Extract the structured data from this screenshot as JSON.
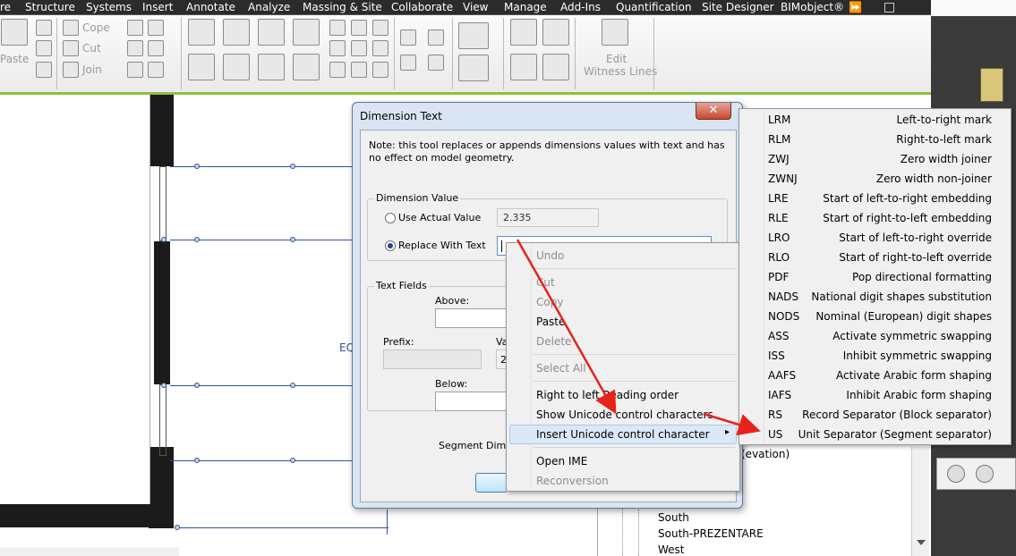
{
  "menubar": {
    "items": [
      "re",
      "Structure",
      "Systems",
      "Insert",
      "Annotate",
      "Analyze",
      "Massing & Site",
      "Collaborate",
      "View",
      "Manage",
      "Add-Ins",
      "Quantification",
      "Site Designer",
      "BIMobject®"
    ],
    "overflow": "⏩"
  },
  "ribbon": {
    "paste": "Paste",
    "cope": "Cope",
    "cut": "Cut",
    "join": "Join",
    "edit_witness_1": "Edit",
    "edit_witness_2": "Witness Lines"
  },
  "canvas": {
    "eq_label": "EQ"
  },
  "browser": {
    "items": [
      "(evation)",
      "South",
      "South-PREZENTARE",
      "West"
    ]
  },
  "dialog": {
    "title": "Dimension Text",
    "close": "✕",
    "note": "Note: this tool replaces or appends dimensions values with text and has no effect on model geometry.",
    "dim_value_group": "Dimension Value",
    "use_actual": "Use Actual Value",
    "actual_value": "2.335",
    "replace_with": "Replace With Text",
    "text_fields_group": "Text Fields",
    "above": "Above:",
    "prefix": "Prefix:",
    "value_partial": "Va",
    "value_field_partial": "2",
    "below": "Below:",
    "segment": "Segment Dimen"
  },
  "context_menu": {
    "undo": "Undo",
    "cut": "Cut",
    "copy": "Copy",
    "paste": "Paste",
    "delete": "Delete",
    "select_all": "Select All",
    "rtl": "Right to left Reading order",
    "show_unicode": "Show Unicode control characters",
    "insert_unicode": "Insert Unicode control character",
    "open_ime": "Open IME",
    "reconversion": "Reconversion",
    "submenu_arrow": "▸"
  },
  "submenu": {
    "items": [
      {
        "code": "LRM",
        "desc": "Left-to-right mark"
      },
      {
        "code": "RLM",
        "desc": "Right-to-left mark"
      },
      {
        "code": "ZWJ",
        "desc": "Zero width joiner"
      },
      {
        "code": "ZWNJ",
        "desc": "Zero width non-joiner"
      },
      {
        "code": "LRE",
        "desc": "Start of left-to-right embedding"
      },
      {
        "code": "RLE",
        "desc": "Start of right-to-left embedding"
      },
      {
        "code": "LRO",
        "desc": "Start of left-to-right override"
      },
      {
        "code": "RLO",
        "desc": "Start of right-to-left override"
      },
      {
        "code": "PDF",
        "desc": "Pop directional formatting"
      },
      {
        "code": "NADS",
        "desc": "National digit shapes substitution"
      },
      {
        "code": "NODS",
        "desc": "Nominal (European) digit shapes"
      },
      {
        "code": "ASS",
        "desc": "Activate symmetric swapping"
      },
      {
        "code": "ISS",
        "desc": "Inhibit symmetric swapping"
      },
      {
        "code": "AAFS",
        "desc": "Activate Arabic form shaping"
      },
      {
        "code": "IAFS",
        "desc": "Inhibit Arabic form shaping"
      },
      {
        "code": "RS",
        "desc": "Record Separator (Block separator)"
      },
      {
        "code": "US",
        "desc": "Unit Separator (Segment separator)"
      }
    ]
  },
  "colors": {
    "arrow": "#e8231b",
    "ribbon_green": "#8cbf3f",
    "menu_highlight": "#dce8f7"
  }
}
